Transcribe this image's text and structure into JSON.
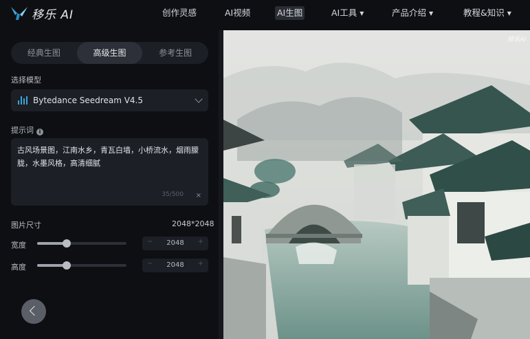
{
  "brand": {
    "name": "移乐 AI"
  },
  "nav": [
    {
      "label": "创作灵感",
      "caret": false,
      "active": false
    },
    {
      "label": "AI视频",
      "caret": false,
      "active": false
    },
    {
      "label": "AI生图",
      "caret": false,
      "active": true
    },
    {
      "label": "AI工具",
      "caret": true,
      "active": false
    },
    {
      "label": "产品介绍",
      "caret": true,
      "active": false
    },
    {
      "label": "教程&知识",
      "caret": true,
      "active": false
    }
  ],
  "tabs": [
    "经典生图",
    "高级生图",
    "参考生图"
  ],
  "model": {
    "label": "选择模型",
    "selected": "Bytedance Seedream V4.5",
    "icon": "bars-icon",
    "icon_color": "#3aa7d8"
  },
  "prompt": {
    "label": "提示词",
    "text": "古风场景图，江南水乡，青瓦白墙，小桥流水，烟雨朦胧，水墨风格，高清细腻",
    "counter": "35/500",
    "clear": "×"
  },
  "size": {
    "label": "图片尺寸",
    "value": "2048*2048",
    "width": {
      "label": "宽度",
      "value": "2048",
      "fraction": 0.33
    },
    "height": {
      "label": "高度",
      "value": "2048",
      "fraction": 0.33
    }
  },
  "image": {
    "watermark": "移乐AI"
  },
  "colors": {
    "accent": "#3aa7d8",
    "panel": "#1c1f25",
    "background": "#0d0f13"
  }
}
